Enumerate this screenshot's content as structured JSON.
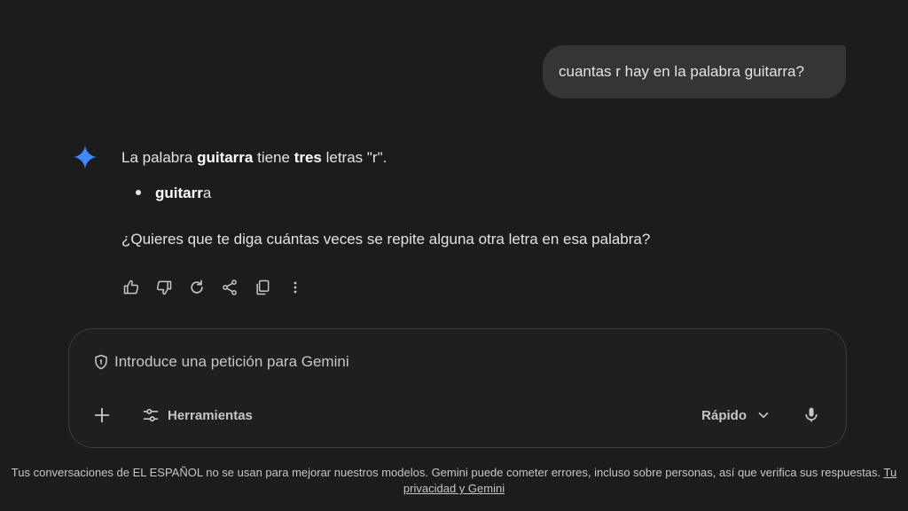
{
  "user_message": "cuantas r hay en la palabra guitarra?",
  "response": {
    "line1": {
      "p1": "La palabra ",
      "b1": "guitarra",
      "p2": " tiene ",
      "b2": "tres",
      "p3": " letras \"r\"."
    },
    "bullet": {
      "bold": "guitarr",
      "rest": "a"
    },
    "question": "¿Quieres que te diga cuántas veces se repite alguna otra letra en esa palabra?"
  },
  "actions": [
    "thumb-up-icon",
    "thumb-down-icon",
    "regenerate-icon",
    "share-icon",
    "copy-icon",
    "more-vert-icon"
  ],
  "composer": {
    "placeholder": "Introduce una petición para Gemini",
    "tools_label": "Herramientas",
    "mode_label": "Rápido"
  },
  "footer": {
    "text": "Tus conversaciones de EL ESPAÑOL no se usan para mejorar nuestros modelos. Gemini puede cometer errores, incluso sobre personas, así que verifica sus respuestas. ",
    "link": "Tu privacidad y Gemini"
  },
  "colors": {
    "background": "#1b1c1d",
    "bubble": "#333537",
    "text": "#e3e3e3",
    "muted": "#c4c7c5",
    "gemini_blue": "#4285f4"
  }
}
